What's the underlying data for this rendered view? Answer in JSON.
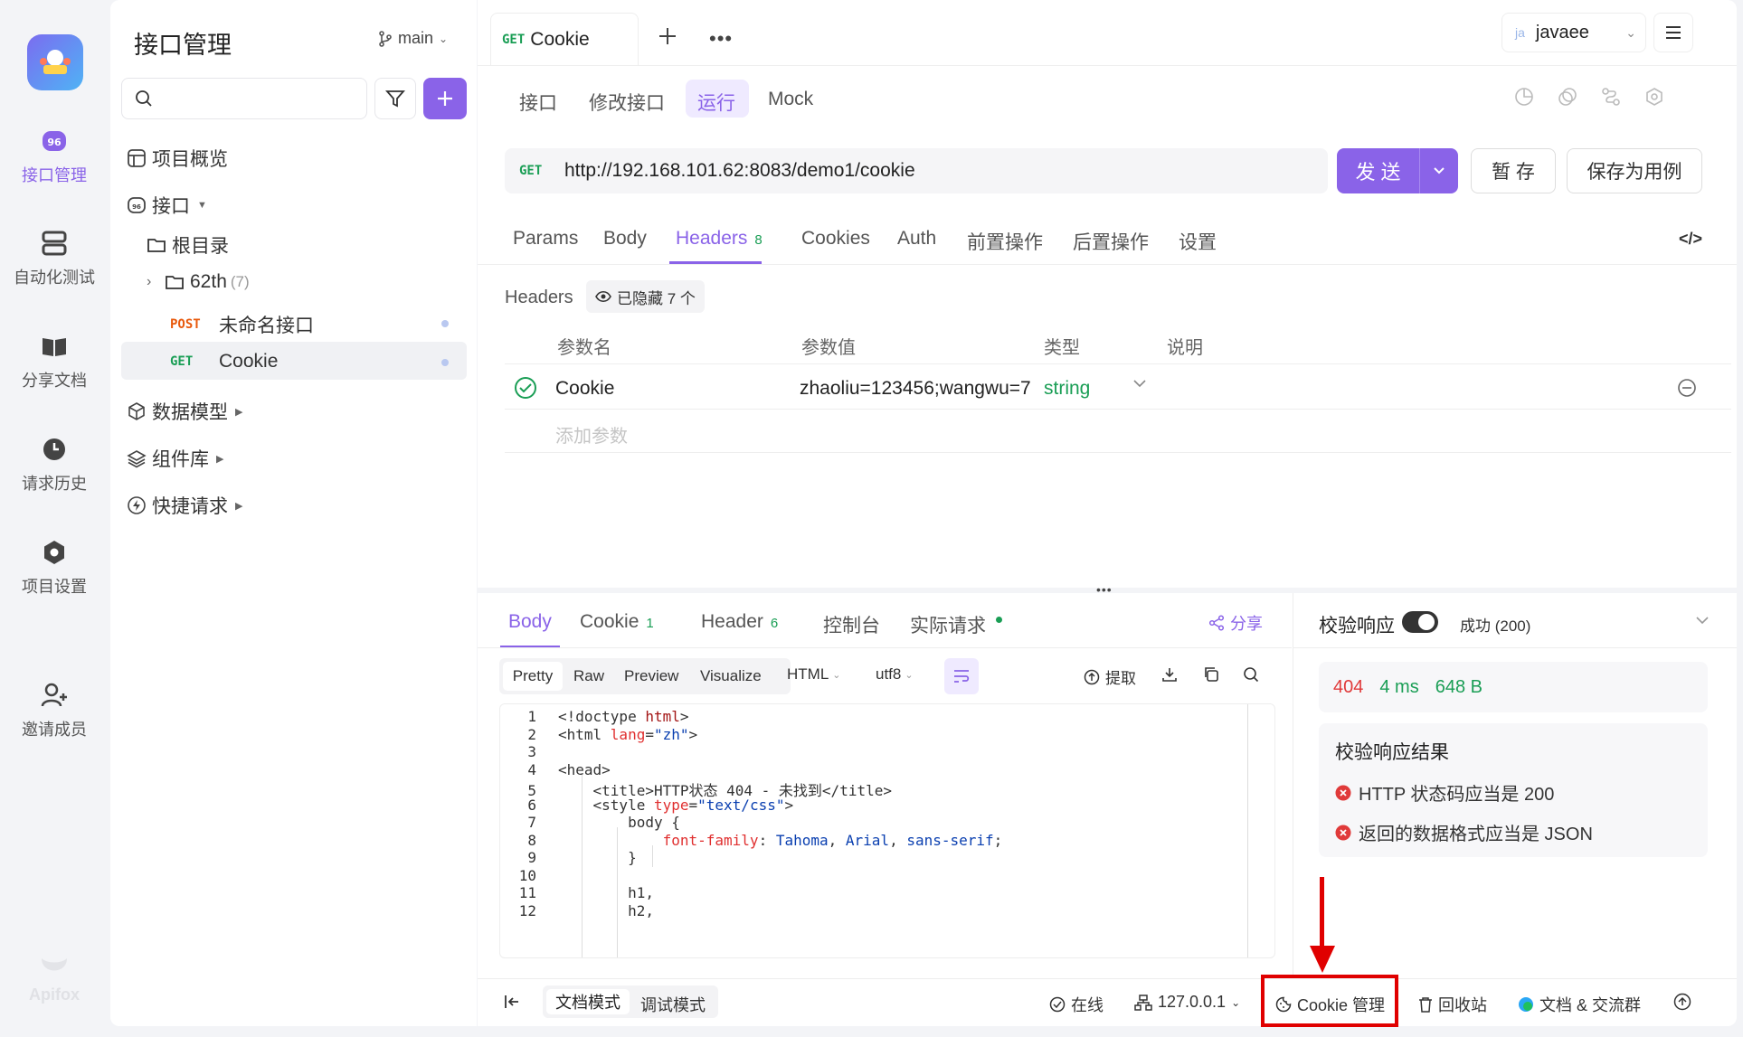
{
  "rail": {
    "items": [
      {
        "label": "接口管理",
        "icon": "api-icon"
      },
      {
        "label": "自动化测试",
        "icon": "automation-icon"
      },
      {
        "label": "分享文档",
        "icon": "docs-icon"
      },
      {
        "label": "请求历史",
        "icon": "history-icon"
      },
      {
        "label": "项目设置",
        "icon": "settings-icon"
      },
      {
        "label": "邀请成员",
        "icon": "invite-icon"
      }
    ],
    "brand": "Apifox"
  },
  "tree": {
    "title": "接口管理",
    "branch": "main",
    "search_placeholder": "",
    "overview": "项目概览",
    "interfaces": "接口",
    "root": "根目录",
    "folder_name": "62th",
    "folder_count": "(7)",
    "items": [
      {
        "method": "POST",
        "name": "未命名接口"
      },
      {
        "method": "GET",
        "name": "Cookie"
      }
    ],
    "data_models": "数据模型",
    "components": "组件库",
    "quick_request": "快捷请求"
  },
  "tabbar": {
    "tab_method": "GET",
    "tab_name": "Cookie",
    "env_prefix": "ja",
    "env_name": "javaee"
  },
  "subtabs": [
    "接口",
    "修改接口",
    "运行",
    "Mock"
  ],
  "request": {
    "method": "GET",
    "url": "http://192.168.101.62:8083/demo1/cookie",
    "send": "发 送",
    "save_temp": "暂 存",
    "save_case": "保存为用例"
  },
  "param_tabs": [
    {
      "label": "Params",
      "count": ""
    },
    {
      "label": "Body",
      "count": ""
    },
    {
      "label": "Headers",
      "count": "8"
    },
    {
      "label": "Cookies",
      "count": ""
    },
    {
      "label": "Auth",
      "count": ""
    },
    {
      "label": "前置操作",
      "count": ""
    },
    {
      "label": "后置操作",
      "count": ""
    },
    {
      "label": "设置",
      "count": ""
    }
  ],
  "headers": {
    "section_label": "Headers",
    "hidden_label": "已隐藏 7 个",
    "columns": [
      "参数名",
      "参数值",
      "类型",
      "说明"
    ],
    "rows": [
      {
        "name": "Cookie",
        "value": "zhaoliu=123456;wangwu=7",
        "type": "string",
        "desc": ""
      }
    ],
    "add_placeholder": "添加参数"
  },
  "response": {
    "tabs": [
      {
        "label": "Body",
        "count": ""
      },
      {
        "label": "Cookie",
        "count": "1"
      },
      {
        "label": "Header",
        "count": "6"
      },
      {
        "label": "控制台",
        "count": ""
      },
      {
        "label": "实际请求",
        "count": ""
      }
    ],
    "share": "分享",
    "view_modes": [
      "Pretty",
      "Raw",
      "Preview",
      "Visualize"
    ],
    "format": "HTML",
    "encoding": "utf8",
    "extract": "提取",
    "code_lines": [
      {
        "n": "1",
        "text": "<!doctype html>"
      },
      {
        "n": "2",
        "text": "<html lang=\"zh\">"
      },
      {
        "n": "3",
        "text": ""
      },
      {
        "n": "4",
        "text": "<head>"
      },
      {
        "n": "5",
        "text": "    <title>HTTP状态 404 - 未找到</title>"
      },
      {
        "n": "6",
        "text": "    <style type=\"text/css\">"
      },
      {
        "n": "7",
        "text": "        body {"
      },
      {
        "n": "8",
        "text": "            font-family: Tahoma, Arial, sans-serif;"
      },
      {
        "n": "9",
        "text": "        }"
      },
      {
        "n": "10",
        "text": ""
      },
      {
        "n": "11",
        "text": "        h1,"
      },
      {
        "n": "12",
        "text": "        h2,"
      }
    ]
  },
  "validation": {
    "label": "校验响应",
    "status": "成功 (200)",
    "code": "404",
    "time": "4 ms",
    "size": "648 B",
    "result_title": "校验响应结果",
    "errors": [
      "HTTP 状态码应当是 200",
      "返回的数据格式应当是 JSON"
    ]
  },
  "footer": {
    "doc_mode": "文档模式",
    "debug_mode": "调试模式",
    "online": "在线",
    "ip": "127.0.0.1",
    "cookie_mgr": "Cookie 管理",
    "recycle": "回收站",
    "community": "文档 & 交流群"
  },
  "colors": {
    "accent": "#8a63e8",
    "success": "#1a9e55",
    "error": "#e03a3a",
    "annotation": "#e00000"
  }
}
